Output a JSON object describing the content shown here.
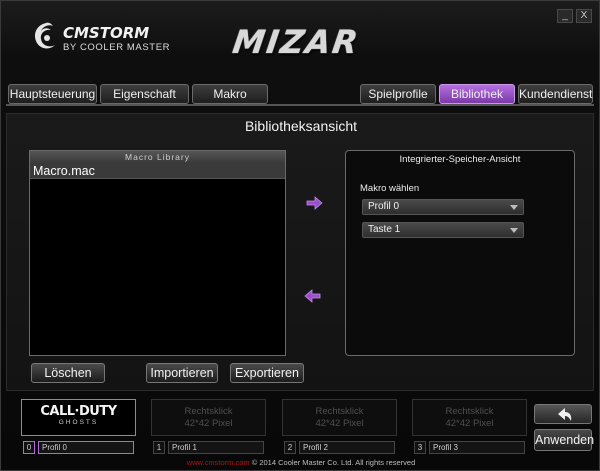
{
  "window": {
    "minimize_label": "_",
    "close_label": "X"
  },
  "brand": {
    "logo_text": "CMSTORM",
    "logo_sub": "BY COOLER MASTER",
    "product_title": "MIZAR"
  },
  "tabs": [
    {
      "label": "Hauptsteuerung",
      "active": false
    },
    {
      "label": "Eigenschaft",
      "active": false
    },
    {
      "label": "Makro",
      "active": false
    },
    {
      "label": "Spielprofile",
      "active": false
    },
    {
      "label": "Bibliothek",
      "active": true
    },
    {
      "label": "Kundendienst",
      "active": false
    }
  ],
  "library": {
    "page_title": "Bibliotheksansicht",
    "list_header": "Macro Library",
    "items": [
      "Macro.mac"
    ]
  },
  "memory": {
    "title": "Integrierter-Speicher-Ansicht",
    "select_label": "Makro wählen",
    "profile_value": "Profil 0",
    "key_value": "Taste 1"
  },
  "buttons": {
    "delete": "Löschen",
    "import": "Importieren",
    "export": "Exportieren",
    "apply": "Anwenden"
  },
  "profiles": [
    {
      "num": "0",
      "name": "Profil 0",
      "slot_line1": "CALL·DUTY",
      "slot_line2": "GHOSTS",
      "selected": true
    },
    {
      "num": "1",
      "name": "Profil 1",
      "slot_line1": "Rechtsklick",
      "slot_line2": "42*42 Pixel",
      "selected": false
    },
    {
      "num": "2",
      "name": "Profil 2",
      "slot_line1": "Rechtsklick",
      "slot_line2": "42*42 Pixel",
      "selected": false
    },
    {
      "num": "3",
      "name": "Profil 3",
      "slot_line1": "Rechtsklick",
      "slot_line2": "42*42 Pixel",
      "selected": false
    }
  ],
  "footer": {
    "site": "www.cmstorm.com",
    "copyright": "© 2014 Cooler Master Co. Ltd. All rights reserved"
  },
  "colors": {
    "accent": "#9b4fcf",
    "background": "#0a0a0a",
    "footer_site": "#b01515"
  },
  "icons": {
    "logo": "storm-swirl-icon",
    "move_right": "arrow-right-icon",
    "move_left": "arrow-left-icon",
    "undo": "undo-arrow-icon"
  }
}
